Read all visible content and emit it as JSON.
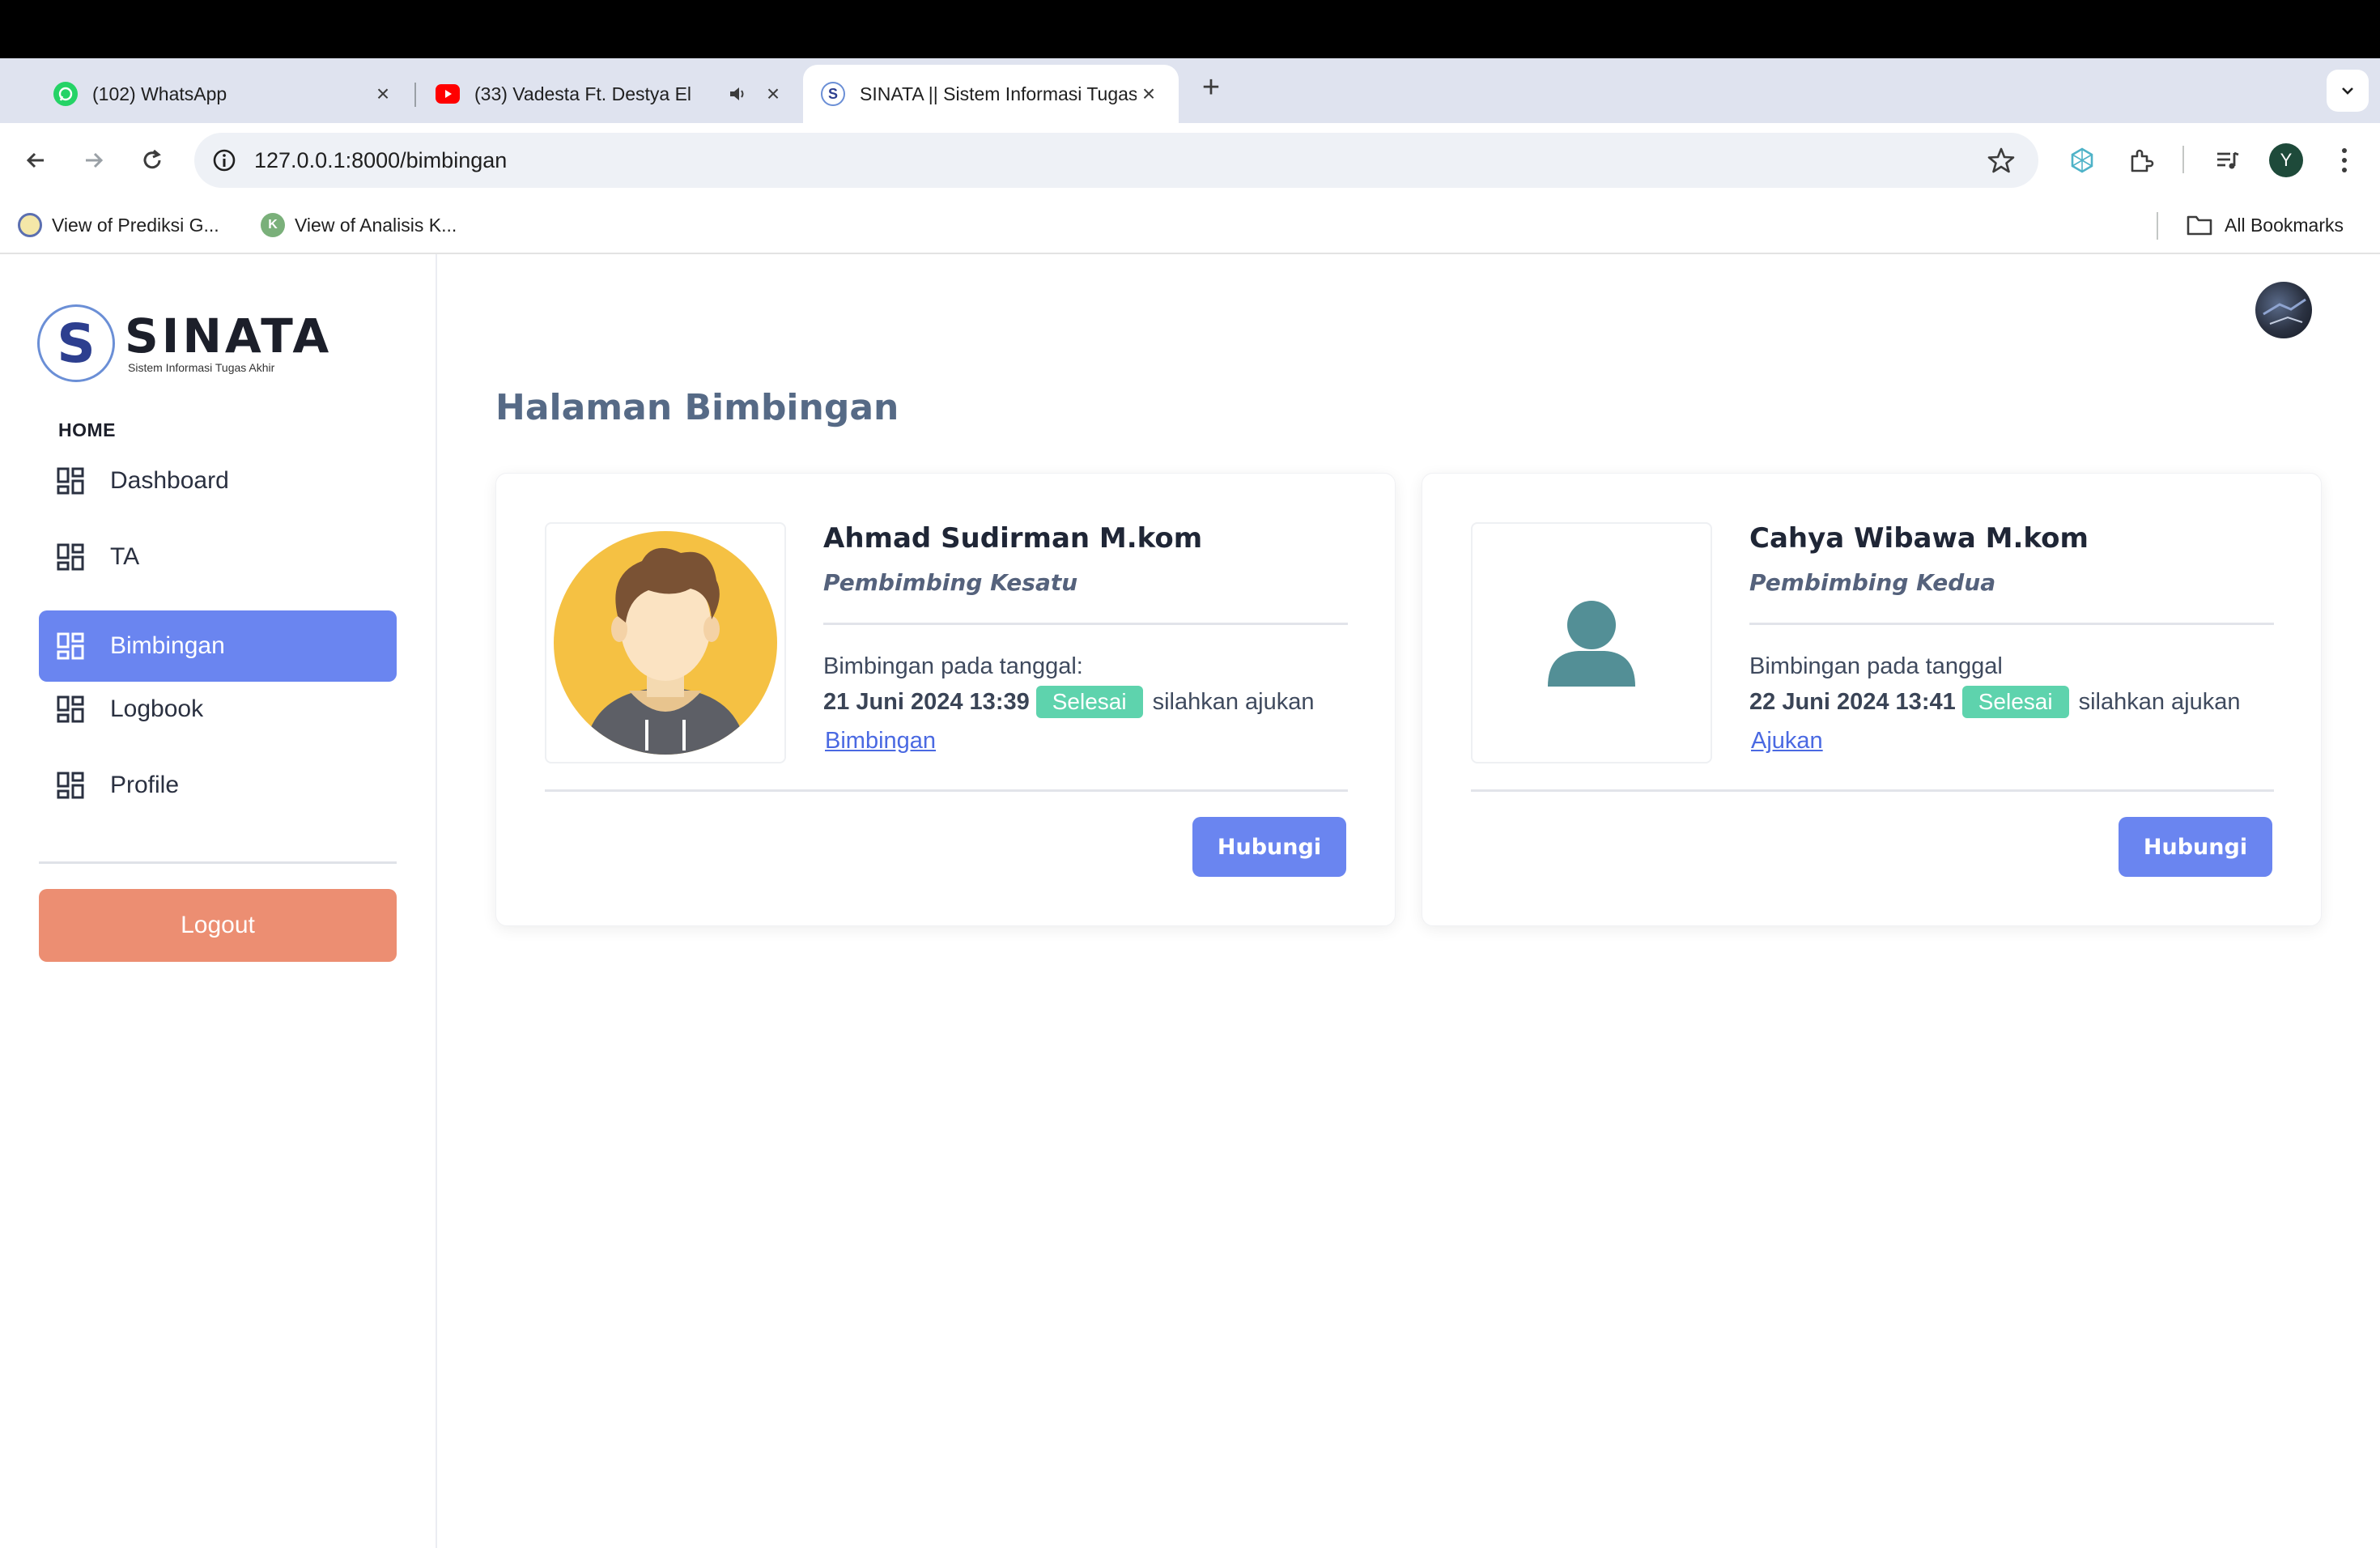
{
  "browser": {
    "tabs": [
      {
        "title": "(102) WhatsApp",
        "icon": "whatsapp-icon"
      },
      {
        "title": "(33) Vadesta Ft. Destya El",
        "icon": "youtube-icon"
      },
      {
        "title": "SINATA || Sistem Informasi Tugas Akhir",
        "icon": "sinata-favicon"
      }
    ],
    "url": "127.0.0.1:8000/bimbingan",
    "profile_initial": "Y",
    "bookmarks": [
      {
        "label": "View of Prediksi G..."
      },
      {
        "label": "View of Analisis K...",
        "icon_letter": "K"
      }
    ],
    "all_bookmarks": "All Bookmarks"
  },
  "sidebar": {
    "brand": "SINATA",
    "tagline": "Sistem Informasi Tugas Akhir",
    "logo_letter": "S",
    "section": "HOME",
    "items": [
      {
        "label": "Dashboard"
      },
      {
        "label": "TA"
      },
      {
        "label": "Bimbingan",
        "active": true
      },
      {
        "label": "Logbook"
      },
      {
        "label": "Profile"
      }
    ],
    "logout": "Logout"
  },
  "main": {
    "title": "Halaman Bimbingan",
    "cards": [
      {
        "name": "Ahmad Sudirman M.kom",
        "role": "Pembimbing Kesatu",
        "info": "Bimbingan pada tanggal:",
        "date": "21 Juni 2024 13:39",
        "status": "Selesai",
        "after": "silahkan ajukan",
        "link": "Bimbingan",
        "button": "Hubungi"
      },
      {
        "name": "Cahya Wibawa M.kom",
        "role": "Pembimbing Kedua",
        "info": "Bimbingan pada tanggal",
        "date": "22 Juni 2024 13:41",
        "status": "Selesai",
        "after": "silahkan ajukan",
        "link": "Ajukan",
        "button": "Hubungi"
      }
    ]
  },
  "colors": {
    "primary": "#6a85f0",
    "logout": "#ec8e72",
    "status_done": "#5ed3ad",
    "title": "#566a86"
  }
}
